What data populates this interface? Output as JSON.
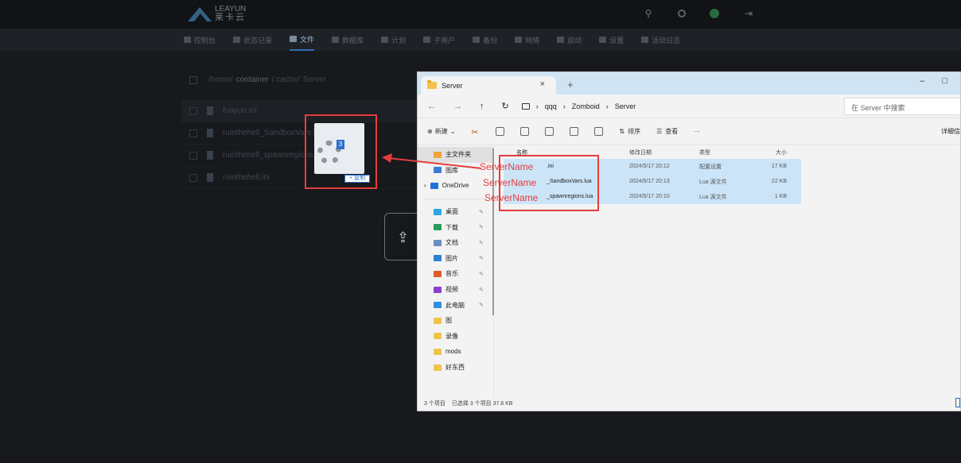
{
  "logo": {
    "brand": "LEAYUN",
    "sub": "莱卡云"
  },
  "nav": {
    "items": [
      {
        "label": "控制台",
        "active": false
      },
      {
        "label": "状态记录",
        "active": false
      },
      {
        "label": "文件",
        "active": true
      },
      {
        "label": "数据库",
        "active": false
      },
      {
        "label": "计划",
        "active": false
      },
      {
        "label": "子用户",
        "active": false
      },
      {
        "label": "备份",
        "active": false
      },
      {
        "label": "网络",
        "active": false
      },
      {
        "label": "启动",
        "active": false
      },
      {
        "label": "设置",
        "active": false
      },
      {
        "label": "活动日志",
        "active": false
      }
    ]
  },
  "breadcrumb": {
    "parts": [
      "/home/",
      "container",
      "/.cache/",
      "Server"
    ]
  },
  "bg_files": [
    "fuayun.ini",
    "ruinthehell_SandboxVars.lua",
    "ruinthehell_spawnregions.lua",
    "ruinthehell.ini"
  ],
  "drag": {
    "badge": "3",
    "copy_label": "+ 复制"
  },
  "explorer": {
    "tab_title": "Server",
    "tab_close": "×",
    "tab_add": "+",
    "win_controls": [
      "–",
      "□"
    ],
    "nav_buttons": [
      "←",
      "→",
      "↑",
      "↻"
    ],
    "path": [
      "qqq",
      "Zomboid",
      "Server"
    ],
    "path_sep": "›",
    "search_placeholder": "在 Server 中搜索",
    "toolbar": {
      "new_label": "新建",
      "new_caret": "⌄",
      "sort_label": "排序",
      "view_label": "查看",
      "more": "···",
      "detail_label": "详细信"
    },
    "columns": {
      "name": "名称",
      "date": "修改日期",
      "type": "类型",
      "size": "大小"
    },
    "sidebar": [
      {
        "label": "主文件夹",
        "color": "#f2a23a",
        "pinned": false
      },
      {
        "label": "图库",
        "color": "#3a7bd5",
        "pinned": false
      },
      {
        "label": "OneDrive",
        "color": "#1e73d9",
        "pinned": false
      },
      {
        "label": "桌面",
        "color": "#2ea7e0",
        "pinned": true
      },
      {
        "label": "下载",
        "color": "#2a9d5a",
        "pinned": true
      },
      {
        "label": "文档",
        "color": "#6b8fbf",
        "pinned": true
      },
      {
        "label": "图片",
        "color": "#2f7fd6",
        "pinned": true
      },
      {
        "label": "音乐",
        "color": "#e05b2a",
        "pinned": true
      },
      {
        "label": "视频",
        "color": "#8b3fd1",
        "pinned": true
      },
      {
        "label": "此电脑",
        "color": "#2e8fe0",
        "pinned": true
      },
      {
        "label": "图",
        "color": "#f2c34a",
        "pinned": false
      },
      {
        "label": "录像",
        "color": "#f2c34a",
        "pinned": false
      },
      {
        "label": "mods",
        "color": "#f2c34a",
        "pinned": false
      },
      {
        "label": "好东西",
        "color": "#f2c34a",
        "pinned": false
      }
    ],
    "files": [
      {
        "name": ".ini",
        "date": "2024/5/17 20:12",
        "type": "配置设置",
        "size": "17 KB"
      },
      {
        "name": "_SandboxVars.lua",
        "date": "2024/5/17 20:13",
        "type": "Lua 源文件",
        "size": "22 KB"
      },
      {
        "name": "_spawnregions.lua",
        "date": "2024/5/17 20:10",
        "type": "Lua 源文件",
        "size": "1 KB"
      }
    ],
    "status": {
      "count": "3 个项目",
      "selected": "已选择 3 个项目 37.8 KB"
    }
  },
  "annotation": {
    "prefix": "ServerName"
  }
}
